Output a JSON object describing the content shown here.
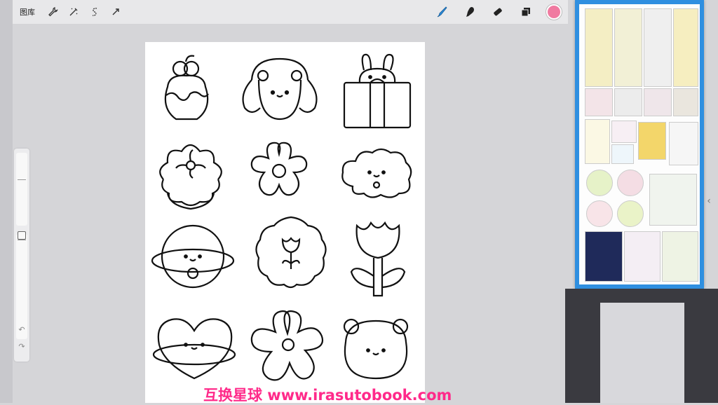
{
  "toolbar": {
    "gallery_label": "图库",
    "left_tools": [
      {
        "name": "actions-icon"
      },
      {
        "name": "adjustments-icon"
      },
      {
        "name": "selection-icon"
      },
      {
        "name": "transform-icon"
      }
    ],
    "right_tools": [
      {
        "name": "brush-icon"
      },
      {
        "name": "smudge-icon"
      },
      {
        "name": "eraser-icon"
      },
      {
        "name": "layers-icon"
      }
    ],
    "current_color": "#f07aa0"
  },
  "watermark": {
    "text": "互换星球 www.irasutobook.com",
    "color": "#ff2a8a"
  }
}
